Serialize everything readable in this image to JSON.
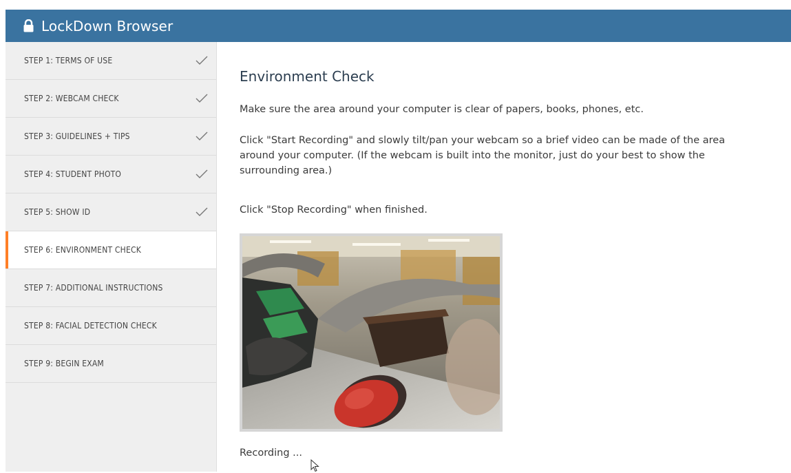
{
  "app": {
    "title": "LockDown Browser"
  },
  "steps": [
    {
      "label": "STEP 1: TERMS OF USE",
      "done": true
    },
    {
      "label": "STEP 2: WEBCAM CHECK",
      "done": true
    },
    {
      "label": "STEP 3: GUIDELINES + TIPS",
      "done": true
    },
    {
      "label": "STEP 4: STUDENT PHOTO",
      "done": true
    },
    {
      "label": "STEP 5: SHOW ID",
      "done": true
    },
    {
      "label": "STEP 6: ENVIRONMENT CHECK",
      "done": false,
      "active": true
    },
    {
      "label": "STEP 7: ADDITIONAL INSTRUCTIONS",
      "done": false
    },
    {
      "label": "STEP 8: FACIAL DETECTION CHECK",
      "done": false
    },
    {
      "label": "STEP 9: BEGIN EXAM",
      "done": false
    }
  ],
  "main": {
    "heading": "Environment Check",
    "instruction1": "Make sure the area around your computer is clear of papers, books, phones, etc.",
    "instruction2": "Click \"Start Recording\" and slowly tilt/pan your webcam so a brief video can be made of the area around your computer. (If the webcam is built into the monitor, just do your best to show the surrounding area.)",
    "instruction3": "Click \"Stop Recording\" when finished.",
    "status": "Recording ..."
  },
  "colors": {
    "titlebar": "#3a73a0",
    "active_accent": "#ff7f27",
    "sidebar_bg": "#efefef"
  }
}
